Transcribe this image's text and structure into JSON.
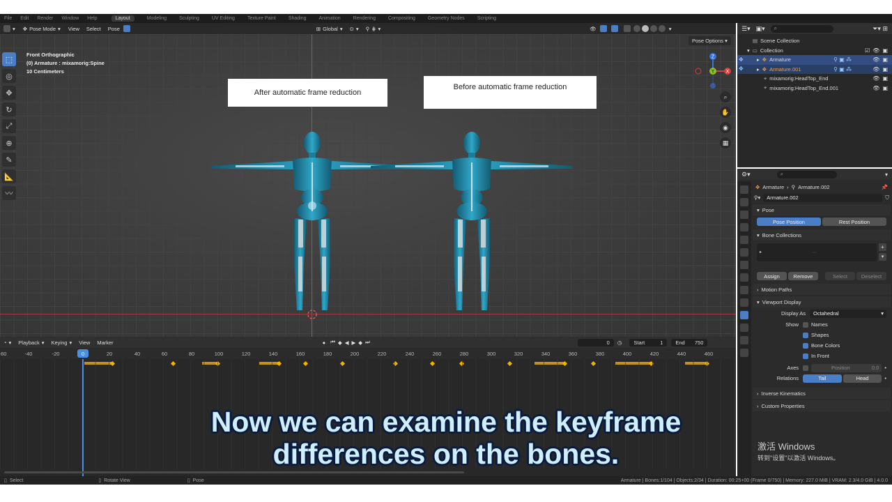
{
  "top_menu": [
    "File",
    "Edit",
    "Render",
    "Window",
    "Help"
  ],
  "workspaces": [
    "Layout",
    "Modeling",
    "Sculpting",
    "UV Editing",
    "Texture Paint",
    "Shading",
    "Animation",
    "Rendering",
    "Compositing",
    "Geometry Nodes",
    "Scripting"
  ],
  "viewport": {
    "mode": "Pose Mode",
    "menus": [
      "View",
      "Select",
      "Pose"
    ],
    "orientation": "Global",
    "pose_options": "Pose Options",
    "info_line1": "Front Orthographic",
    "info_line2": "(0) Armature : mixamorig:Spine",
    "info_line3": "10 Centimeters",
    "label_after": "After automatic frame reduction",
    "label_before": "Before automatic frame reduction",
    "gizmo": {
      "x": "X",
      "y": "Y",
      "z": "Z"
    }
  },
  "timeline": {
    "menus": [
      "Playback",
      "Keying",
      "View",
      "Marker"
    ],
    "current_frame": "0",
    "start_label": "Start",
    "start_value": "1",
    "end_label": "End",
    "end_value": "750",
    "playhead": "0",
    "ruler": [
      "-60",
      "-40",
      "-20",
      "20",
      "40",
      "60",
      "80",
      "100",
      "120",
      "140",
      "160",
      "180",
      "200",
      "220",
      "240",
      "260",
      "280",
      "300",
      "320",
      "340",
      "360",
      "380",
      "400",
      "420",
      "440",
      "460"
    ]
  },
  "subtitle": {
    "line1": "Now we can examine the keyframe",
    "line2": "differences on the bones."
  },
  "outliner": {
    "scene_collection": "Scene Collection",
    "collection": "Collection",
    "items": [
      {
        "label": "Armature"
      },
      {
        "label": "Armature.001"
      },
      {
        "label": "mixamorig:HeadTop_End"
      },
      {
        "label": "mixamorig:HeadTop_End.001"
      }
    ]
  },
  "properties": {
    "breadcrumb_a": "Armature",
    "breadcrumb_b": "Armature.002",
    "data_name": "Armature.002",
    "pose_section": "Pose",
    "pose_position": "Pose Position",
    "rest_position": "Rest Position",
    "bone_collections": "Bone Collections",
    "assign": "Assign",
    "remove": "Remove",
    "select": "Select",
    "deselect": "Deselect",
    "motion_paths": "Motion Paths",
    "viewport_display": "Viewport Display",
    "display_as_label": "Display As",
    "display_as_value": "Octahedral",
    "show_label": "Show",
    "names": "Names",
    "shapes": "Shapes",
    "bone_colors": "Bone Colors",
    "in_front": "In Front",
    "axes_label": "Axes",
    "position_label": "Position",
    "position_value": "0.0",
    "relations_label": "Relations",
    "tail": "Tail",
    "head": "Head",
    "inverse_kinematics": "Inverse Kinematics",
    "custom_properties": "Custom Properties"
  },
  "watermark": {
    "line1": "激活 Windows",
    "line2": "转到\"设置\"以激活 Windows。"
  },
  "statusbar": {
    "select": "Select",
    "rotate_view": "Rotate View",
    "pose": "Pose",
    "info": "Armature | Bones:1/104 | Objects:2/34 | Duration: 00:25+00 (Frame 0/750) | Memory: 227.0 MiB | VRAM: 2.3/4.0 GiB | 4.0.0"
  },
  "colors": {
    "accent": "#4a7ec7",
    "character": "#2a8fb0",
    "subtitle": "#cfeefe",
    "keyframe": "#f0b400"
  }
}
